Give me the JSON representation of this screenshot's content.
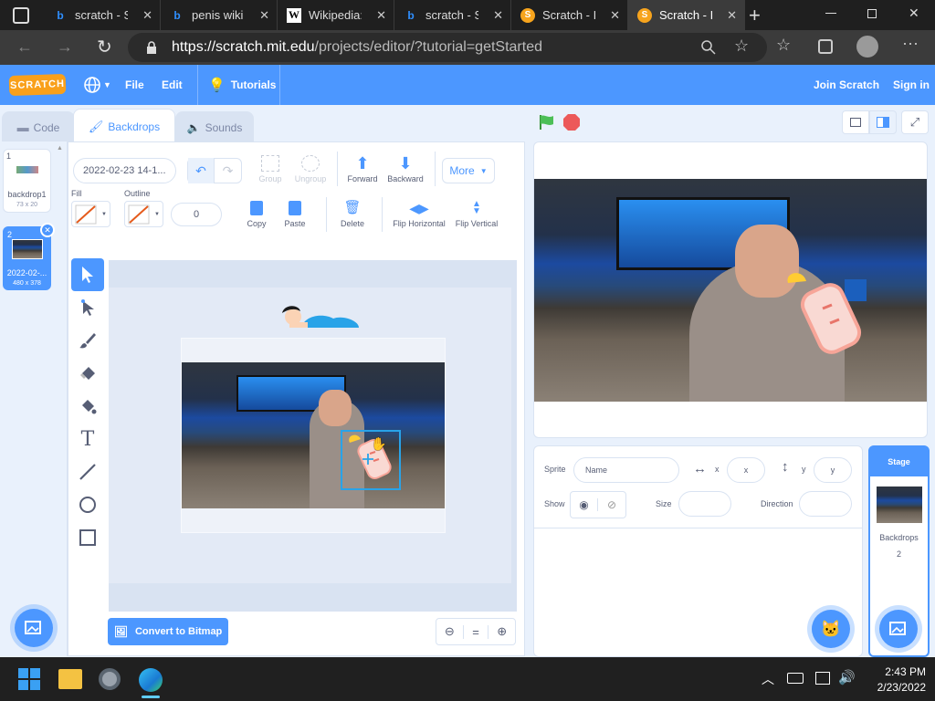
{
  "browser": {
    "tabs": [
      {
        "title": "scratch - Se",
        "icon": "bing-icon"
      },
      {
        "title": "penis wiki -",
        "icon": "bing-icon"
      },
      {
        "title": "Wikipedia:A",
        "icon": "wikipedia-icon"
      },
      {
        "title": "scratch - Sc",
        "icon": "bing-icon"
      },
      {
        "title": "Scratch - Im",
        "icon": "scratch-icon"
      },
      {
        "title": "Scratch - Im",
        "icon": "scratch-icon"
      }
    ],
    "url_host": "https://scratch.mit.edu",
    "url_path": "/projects/editor/?tutorial=getStarted"
  },
  "menubar": {
    "logo": "SCRATCH",
    "file": "File",
    "edit": "Edit",
    "tutorials": "Tutorials",
    "join": "Join Scratch",
    "signin": "Sign in"
  },
  "editor_tabs": {
    "code": "Code",
    "backdrops": "Backdrops",
    "sounds": "Sounds"
  },
  "backdrops": [
    {
      "num": "1",
      "name": "backdrop1",
      "size": "73 x 20"
    },
    {
      "num": "2",
      "name": "2022-02-...",
      "size": "480 x 378"
    }
  ],
  "paint": {
    "costume_name": "2022-02-23 14-1...",
    "group": "Group",
    "ungroup": "Ungroup",
    "forward": "Forward",
    "backward": "Backward",
    "more": "More",
    "fill_label": "Fill",
    "outline_label": "Outline",
    "outline_width": "0",
    "copy": "Copy",
    "paste": "Paste",
    "delete": "Delete",
    "flip_h": "Flip Horizontal",
    "flip_v": "Flip Vertical",
    "convert": "Convert to Bitmap"
  },
  "sprite_info": {
    "sprite_label": "Sprite",
    "name_placeholder": "Name",
    "x_label": "x",
    "x_placeholder": "x",
    "y_label": "y",
    "y_placeholder": "y",
    "show_label": "Show",
    "size_label": "Size",
    "direction_label": "Direction"
  },
  "stage_panel": {
    "title": "Stage",
    "backdrops_label": "Backdrops",
    "backdrops_count": "2"
  },
  "taskbar": {
    "time": "2:43 PM",
    "date": "2/23/2022"
  },
  "colors": {
    "scratch_blue": "#4c97ff",
    "flag_green": "#4cbf56",
    "stop_red": "#ec5959",
    "delete_red": "#ec5959"
  }
}
